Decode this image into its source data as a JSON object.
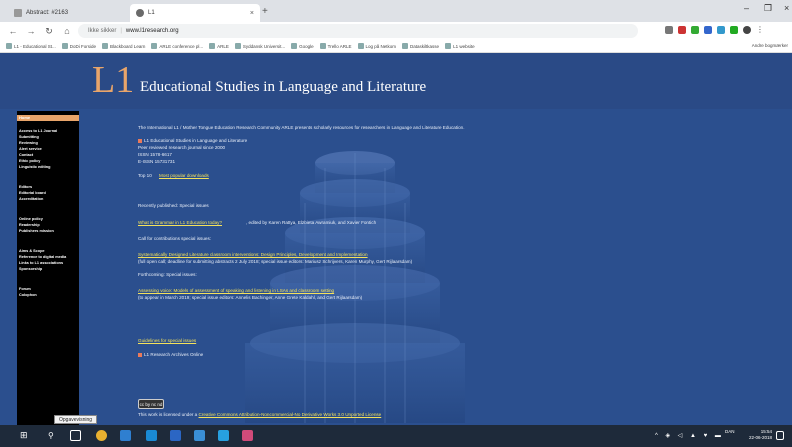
{
  "browser": {
    "tabs": [
      {
        "label": "Abstract: #2163",
        "active": false
      },
      {
        "label": "L1",
        "active": true
      }
    ],
    "address": {
      "security": "Ikke sikker",
      "url": "www.l1research.org"
    },
    "bookmarks": [
      "L1 - Educational St...",
      "DoDi Forside",
      "Blackboard Learn",
      "ARLE conference pl...",
      "ARLE",
      "Syddansk Universit...",
      "Google",
      "Trello ARLE",
      "Log på Netkom",
      "Dataskiltkasse",
      "L1 website"
    ],
    "bookmarks_right": "Andre bogmærker"
  },
  "site": {
    "logo": "L1",
    "title": "Educational Studies in Language and Literature"
  },
  "sidebar": {
    "home": "Home",
    "groups": [
      [
        "Access to L1 Journal",
        "Submitting",
        "Reviewing",
        "Alert service",
        "Contact",
        "Ethic policy",
        "Linguistic editing"
      ],
      [
        "Editors",
        "Editorial board",
        "Accreditation"
      ],
      [
        "Online policy",
        "Readership",
        "Publishers mission"
      ],
      [
        "Aims & Scope",
        "Reference to digital media",
        "Links to L1 associations",
        "Sponsorship"
      ],
      [
        "Forum",
        "Colophon"
      ]
    ]
  },
  "content": {
    "intro": "The International L1 / Mother Tongue Education Research Community    ARLE presents scholarly resources for researchers in Language and Literature Education.",
    "journal_name": "L1 Educational Studies in Language and Literature",
    "journal_desc": "Peer reviewed research journal since 2000",
    "issn": "ISSN 1578-6617",
    "eissn": "E-ISSN 15731731",
    "top10_prefix": "Top 10",
    "top10_link": "Most popular downloads",
    "recent_label": "Recently published: Special issues",
    "recent_link": "What is Grammar in L1 Education today?",
    "recent_editors": ", edited by Karen Rattya, Elzbieta Awramiuk, and Xavier Fontich",
    "call_label": "Call for contributions special issues:",
    "call_link": "Systematically Designed Literature classroom interventions: Design Principles, Development and Implementation",
    "call_note": "(full open call; deadline for submitting abstracts 2 July 2018; special issue editors: Mariusz Schrijvers, Karen Murphy, Gert Rijlaarsdam)",
    "forthcoming_label": "Forthcoming: Special issues:",
    "forthcoming_link": "Assessing voice: Models of assessment of speaking and listening in LSAs and classroom setting",
    "forthcoming_note": "(to appear in March 2019; special issue editors: Annelis Bachinger, Anne Grete Kaldahl, and Gert Rijlaarsdam)",
    "guidelines_link": "Guidelines for special issues",
    "archives": "L1 Research Archives Online",
    "license_badge": "cc by nc nd",
    "license_text": "This work is licensed under a ",
    "license_link": "Creative Commons Attribution-Noncommercial-No Derivative Works 3.0 Unported License"
  },
  "taskbar": {
    "tooltip": "Opgavevisning",
    "time": "15:54",
    "date": "22-06-2018",
    "lang": "DAN"
  }
}
